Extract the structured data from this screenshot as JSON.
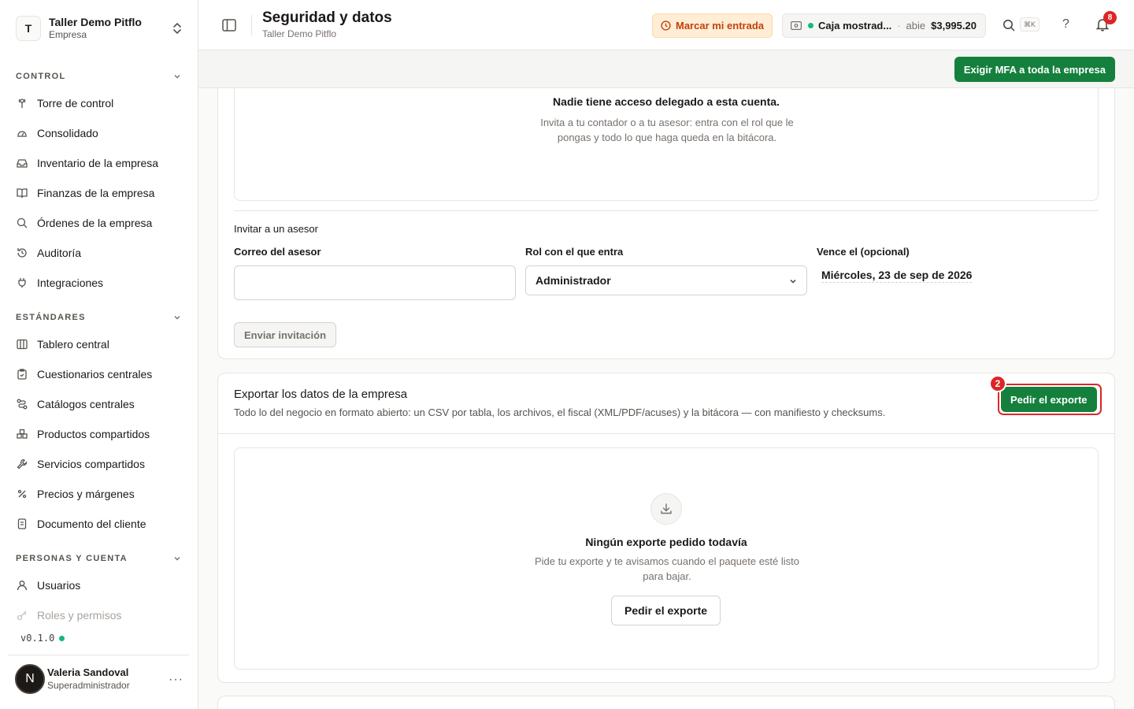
{
  "org": {
    "initial": "T",
    "name": "Taller Demo Pitflo",
    "type": "Empresa"
  },
  "sidebar": {
    "sections": [
      {
        "label": "CONTROL",
        "items": [
          {
            "label": "Torre de control",
            "icon": "tower-icon"
          },
          {
            "label": "Consolidado",
            "icon": "gauge-icon"
          },
          {
            "label": "Inventario de la empresa",
            "icon": "inbox-icon"
          },
          {
            "label": "Finanzas de la empresa",
            "icon": "book-icon"
          },
          {
            "label": "Órdenes de la empresa",
            "icon": "search-icon"
          },
          {
            "label": "Auditoría",
            "icon": "history-icon"
          },
          {
            "label": "Integraciones",
            "icon": "plug-icon"
          }
        ]
      },
      {
        "label": "ESTÁNDARES",
        "items": [
          {
            "label": "Tablero central",
            "icon": "columns-icon"
          },
          {
            "label": "Cuestionarios centrales",
            "icon": "clipboard-icon"
          },
          {
            "label": "Catálogos centrales",
            "icon": "route-icon"
          },
          {
            "label": "Productos compartidos",
            "icon": "boxes-icon"
          },
          {
            "label": "Servicios compartidos",
            "icon": "wrench-icon"
          },
          {
            "label": "Precios y márgenes",
            "icon": "percent-icon"
          },
          {
            "label": "Documento del cliente",
            "icon": "file-icon"
          }
        ]
      },
      {
        "label": "PERSONAS Y CUENTA",
        "items": [
          {
            "label": "Usuarios",
            "icon": "user-icon"
          },
          {
            "label": "Roles y permisos",
            "icon": "key-icon"
          }
        ]
      }
    ],
    "version": "v0.1.0"
  },
  "user": {
    "initial": "N",
    "name": "Valeria Sandoval",
    "role": "Superadministrador"
  },
  "header": {
    "title": "Seguridad y datos",
    "subtitle": "Taller Demo Pitflo",
    "clock_in": "Marcar mi entrada",
    "register": {
      "name": "Caja mostrad...",
      "status": "abie",
      "amount": "$3,995.20"
    },
    "shortcut": "⌘K",
    "notifications": "8"
  },
  "actions": {
    "mfa_button": "Exigir MFA a toda la empresa"
  },
  "delegated": {
    "empty_title": "Nadie tiene acceso delegado a esta cuenta.",
    "empty_desc": "Invita a tu contador o a tu asesor: entra con el rol que le pongas y todo lo que haga queda en la bitácora.",
    "invite_heading": "Invitar a un asesor",
    "email_label": "Correo del asesor",
    "email_value": "",
    "role_label": "Rol con el que entra",
    "role_value": "Administrador",
    "expires_label": "Vence el (opcional)",
    "expires_value": "Miércoles, 23 de sep de 2026",
    "send_button": "Enviar invitación"
  },
  "export": {
    "title": "Exportar los datos de la empresa",
    "desc": "Todo lo del negocio en formato abierto: un CSV por tabla, los archivos, el fiscal (XML/PDF/acuses) y la bitácora — con manifiesto y checksums.",
    "request_button": "Pedir el exporte",
    "step_badge": "2",
    "empty_title": "Ningún exporte pedido todavía",
    "empty_desc": "Pide tu exporte y te avisamos cuando el paquete esté listo para bajar.",
    "empty_button": "Pedir el exporte"
  },
  "colors": {
    "primary": "#15803d",
    "accent_warn": "#c2410c",
    "highlight": "#dc2626",
    "status_ok": "#10b981"
  }
}
